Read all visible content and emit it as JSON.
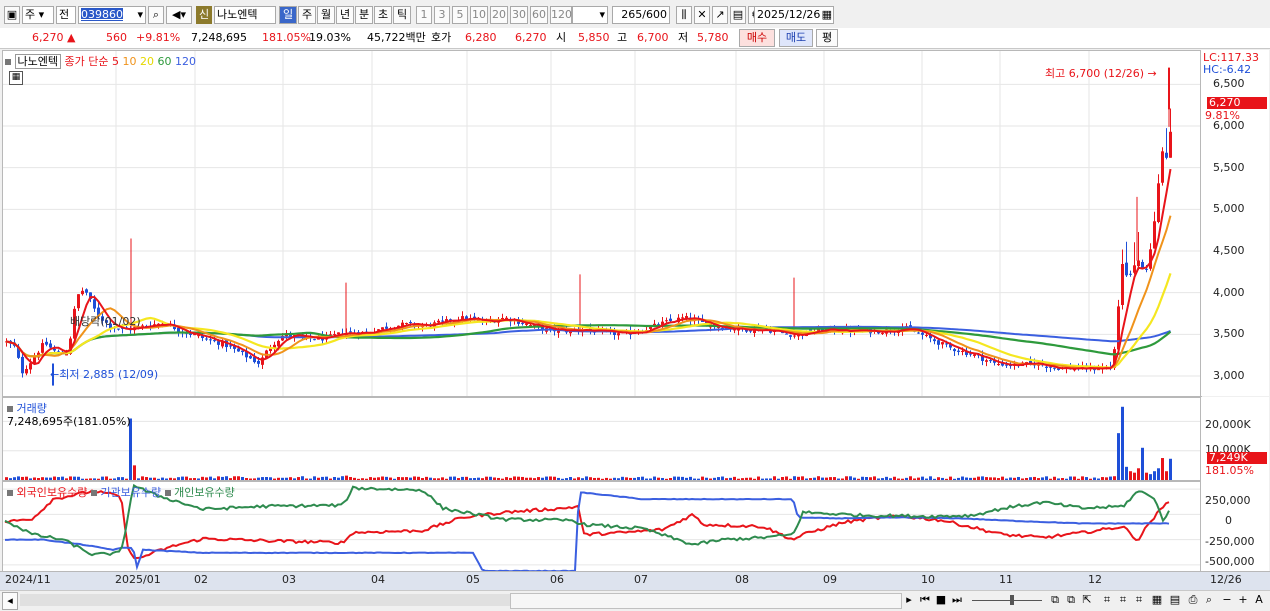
{
  "toolbar": {
    "mode1": "주",
    "mode2": "전",
    "code": "039860",
    "stock_badge": "신",
    "stock_name": "나노엔텍",
    "periods": [
      "일",
      "주",
      "월",
      "년",
      "분",
      "초",
      "틱"
    ],
    "active_period": "일",
    "intervals": [
      "1",
      "3",
      "5",
      "10",
      "20",
      "30",
      "60",
      "120"
    ],
    "count": "265",
    "count_max": "/600",
    "date": "2025/12/26"
  },
  "quote": {
    "price": "6,270",
    "change": "560",
    "change_pct": "+9.81%",
    "volume": "7,248,695",
    "vol_ratio": "181.05%",
    "turnover": "19.03%",
    "amount": "45,722백만",
    "hoga_label": "호가",
    "ask": "6,280",
    "bid": "6,270",
    "open_label": "시",
    "open": "5,850",
    "high_label": "고",
    "high": "6,700",
    "low_label": "저",
    "low": "5,780",
    "buy": "매수",
    "sell": "매도",
    "eval": "평"
  },
  "price_panel": {
    "stock_tag": "나노엔텍",
    "legend_label": "종가 단순",
    "ma_periods": [
      "5",
      "10",
      "20",
      "60",
      "120"
    ],
    "lc": "LC:117.33",
    "hc": "HC:-6.42",
    "ticks": [
      "6,500",
      "6,000",
      "5,500",
      "5,000",
      "4,500",
      "4,000",
      "3,500",
      "3,000"
    ],
    "last_price": "6,270",
    "last_pct": "9.81%",
    "high_note": "최고 6,700 (12/26)",
    "low_note": "최저 2,885 (12/09)",
    "event_note": "배당락(01/02)"
  },
  "volume_panel": {
    "title": "거래량",
    "value": "7,248,695주(181.05%)",
    "ticks": [
      "20,000K",
      "10,000K"
    ],
    "last_value": "7,249K",
    "last_pct": "181.05%"
  },
  "holdings_panel": {
    "series": [
      "외국인보유수량",
      "기관보유수량",
      "개인보유수량"
    ],
    "ticks": [
      "250,000",
      "0",
      "-250,000",
      "-500,000"
    ]
  },
  "x_axis": [
    "2024/11",
    "2025/01",
    "02",
    "03",
    "04",
    "05",
    "06",
    "07",
    "08",
    "09",
    "10",
    "11",
    "12",
    "12/26"
  ],
  "colors": {
    "up": "#e8141a",
    "down": "#1e4fd8",
    "ma5": "#e8141a",
    "ma10": "#f0931b",
    "ma20": "#f5e720",
    "ma60": "#2e9a3c",
    "ma120": "#3b5fe0",
    "foreign": "#e8141a",
    "inst": "#3b5fe0",
    "indiv": "#2e8b4e"
  },
  "chart_data": {
    "type": "candlestick",
    "price_range": [
      2760,
      6900
    ],
    "peak_high": 6700,
    "trough_low": 2885,
    "last_close": 6270,
    "volume_range": [
      0,
      28000
    ],
    "last_volume_k": 7249,
    "holdings_range": [
      -560000,
      320000
    ]
  }
}
